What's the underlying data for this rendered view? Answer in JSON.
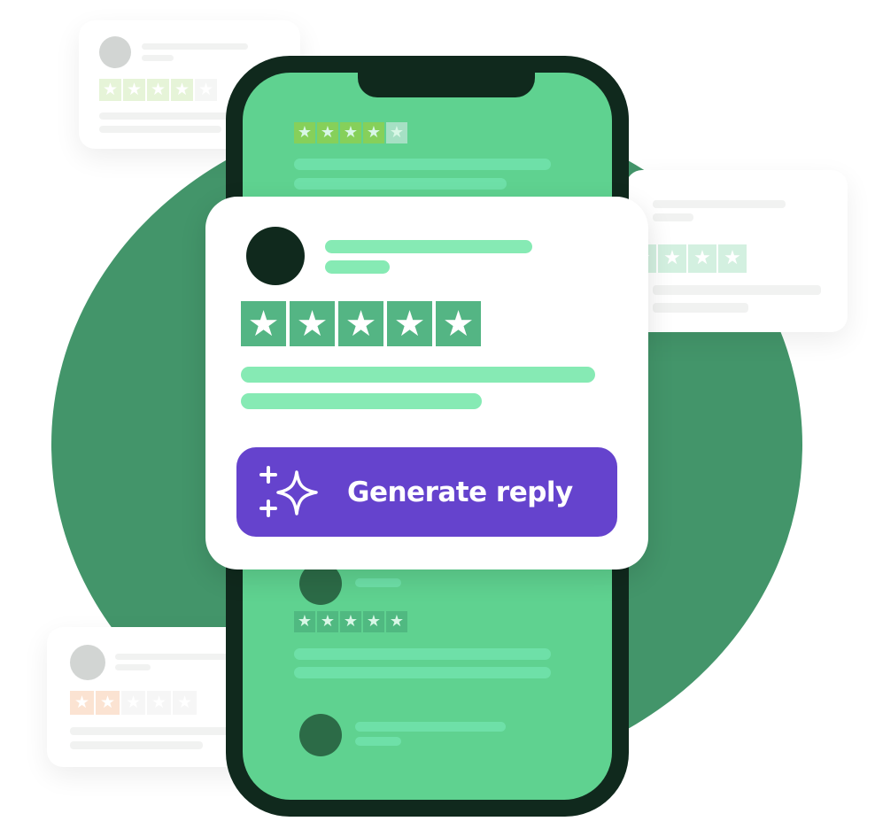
{
  "scene": {
    "colors": {
      "background_circle": "#43956a",
      "phone_frame": "#10291d",
      "phone_screen": "#5fd290",
      "card_bg": "#ffffff",
      "accent_star": "#54b584",
      "skeleton_line": "#86eab4",
      "button_bg": "#6543cd",
      "button_text": "#ffffff",
      "rating_high": "#86d05a",
      "rating_low": "#f5cfb0"
    }
  },
  "main_card": {
    "rating": 5,
    "rating_max": 5,
    "star_glyph": "★",
    "generate_button": {
      "label": "Generate reply",
      "icon": "sparkle-icon"
    }
  },
  "phone_reviews": [
    {
      "rating": 4,
      "rating_max": 5
    },
    {
      "rating": 5,
      "rating_max": 5
    }
  ],
  "ghost_cards": [
    {
      "position": "top-left",
      "rating": 4,
      "rating_max": 5
    },
    {
      "position": "right",
      "rating": 5,
      "rating_max": 5
    },
    {
      "position": "bottom-left",
      "rating": 2,
      "rating_max": 5
    }
  ],
  "glyphs": {
    "star": "★"
  }
}
